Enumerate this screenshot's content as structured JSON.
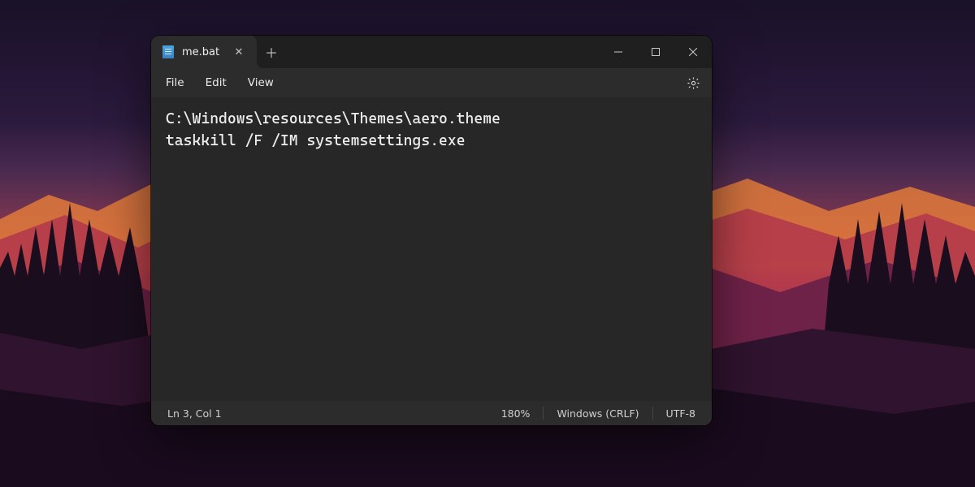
{
  "tab": {
    "title": "me.bat",
    "icon": "text-file-icon",
    "close_label": "✕",
    "new_tab_label": "＋"
  },
  "window_controls": {
    "minimize": "minimize",
    "maximize": "maximize",
    "close": "close"
  },
  "menubar": {
    "file": "File",
    "edit": "Edit",
    "view": "View",
    "settings": "settings"
  },
  "editor": {
    "lines": [
      "C:\\Windows\\resources\\Themes\\aero.theme",
      "taskkill /F /IM systemsettings.exe"
    ],
    "content": "C:\\Windows\\resources\\Themes\\aero.theme\ntaskkill /F /IM systemsettings.exe"
  },
  "statusbar": {
    "position": "Ln 3, Col 1",
    "zoom": "180%",
    "line_ending": "Windows (CRLF)",
    "encoding": "UTF-8"
  },
  "colors": {
    "window_bg": "#272727",
    "chrome_bg": "#2c2c2c",
    "titlebar_bg": "#1f1f1f",
    "text": "#eeeeee"
  }
}
